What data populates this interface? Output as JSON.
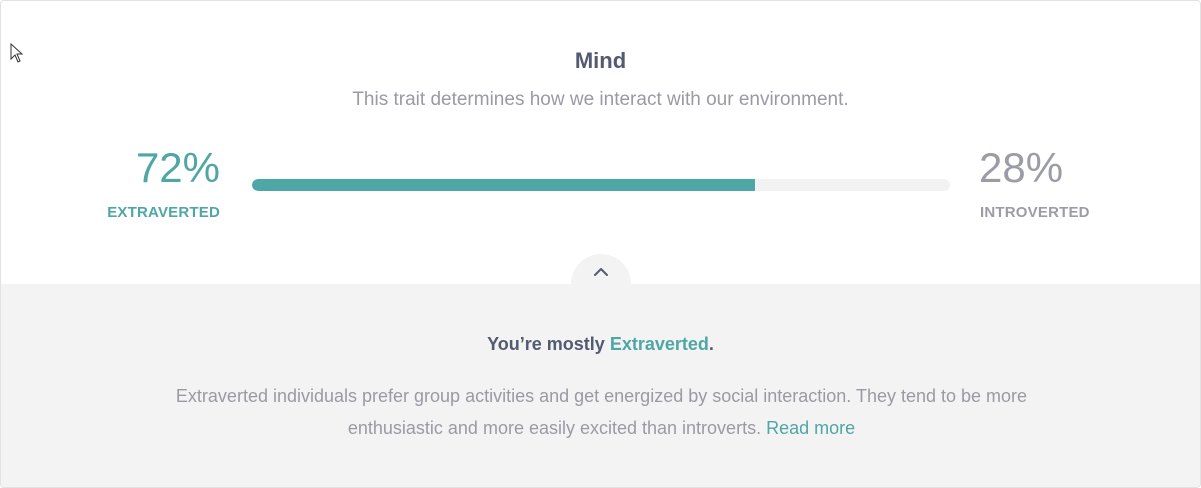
{
  "trait": {
    "title": "Mind",
    "subtitle": "This trait determines how we interact with our environment."
  },
  "left": {
    "percent": "72%",
    "label": "EXTRAVERTED"
  },
  "right": {
    "percent": "28%",
    "label": "INTROVERTED"
  },
  "bar": {
    "fill_fraction": 0.72,
    "fill_color": "#4ea6a5",
    "track_color": "#f2f2f3"
  },
  "result": {
    "prefix": "You’re mostly ",
    "trait": "Extraverted",
    "suffix": "."
  },
  "description": {
    "text": "Extraverted individuals prefer group activities and get energized by social interaction. They tend to be more enthusiastic and more easily excited than introverts.",
    "link": "Read more"
  },
  "colors": {
    "accent": "#4ea6a5",
    "muted": "#9c9ca6",
    "heading": "#545a70",
    "panel": "#f3f3f3"
  },
  "icons": {
    "toggle": "chevron-up-icon",
    "cursor": "mouse-pointer-icon"
  }
}
